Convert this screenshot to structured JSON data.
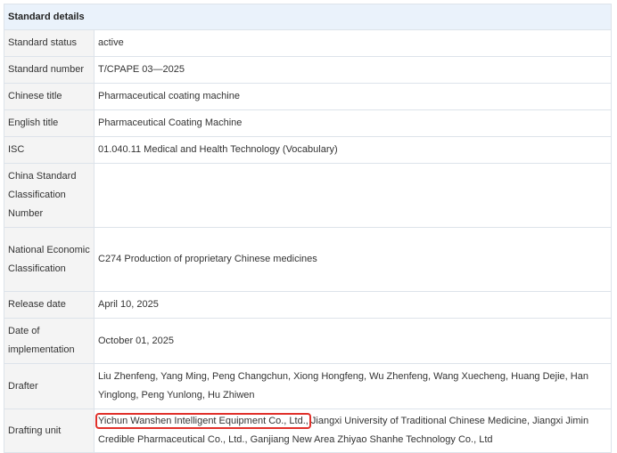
{
  "header": {
    "title": "Standard details"
  },
  "rows": [
    {
      "label": "Standard status",
      "value": "active"
    },
    {
      "label": "Standard number",
      "value": "T/CPAPE 03—2025"
    },
    {
      "label": "Chinese title",
      "value": "Pharmaceutical coating machine"
    },
    {
      "label": "English title",
      "value": "Pharmaceutical Coating Machine"
    },
    {
      "label": "ISC",
      "value": "01.040.11 Medical and Health Technology (Vocabulary)"
    },
    {
      "label": "China Standard Classification Number",
      "value": ""
    },
    {
      "label": "National Economic Classification",
      "value": "C274 Production of proprietary Chinese medicines"
    },
    {
      "label": "Release date",
      "value": "April 10, 2025"
    },
    {
      "label": "Date of implementation",
      "value": "October 01, 2025"
    },
    {
      "label": "Drafter",
      "value": "Liu Zhenfeng, Yang Ming, Peng Changchun, Xiong Hongfeng, Wu Zhenfeng, Wang Xuecheng, Huang Dejie, Han Yinglong, Peng Yunlong, Hu Zhiwen"
    },
    {
      "label": "Drafting unit",
      "highlighted_value": "Yichun Wanshen Intelligent Equipment Co., Ltd.,",
      "value_rest": "Jiangxi University of Traditional Chinese Medicine, Jiangxi Jimin Credible Pharmaceutical Co., Ltd., Ganjiang New Area Zhiyao Shanhe Technology Co., Ltd"
    }
  ],
  "colors": {
    "header_background": "#eaf2fb",
    "label_background": "#f4f4f4",
    "border": "#dde3ea",
    "highlight_box": "#e0302a"
  }
}
